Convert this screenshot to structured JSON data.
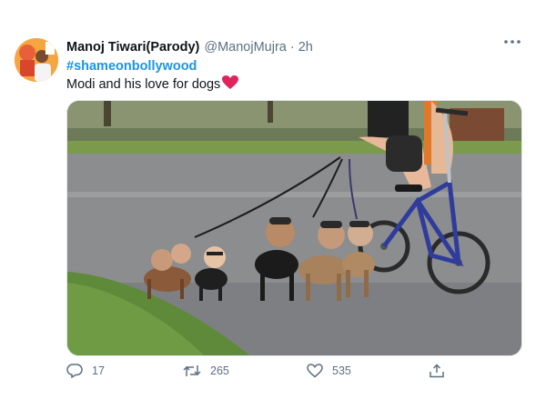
{
  "tweet": {
    "display_name": "Manoj Tiwari(Parody)",
    "handle": "@ManojMujra",
    "separator": "·",
    "time": "2h",
    "hashtag": "#shameonbollywood",
    "text": "Modi and his love for dogs"
  },
  "actions": {
    "reply_count": "17",
    "retweet_count": "265",
    "like_count": "535"
  },
  "icons": {
    "avatar": "avatar-icon",
    "more": "more-options-icon",
    "emoji": "red-heart-icon",
    "reply": "reply-icon",
    "retweet": "retweet-icon",
    "like": "like-icon",
    "share": "share-icon"
  },
  "colors": {
    "link": "#1b95e0",
    "text": "#0f1419",
    "secondary": "#5b7083",
    "heart": "#e0245e"
  }
}
